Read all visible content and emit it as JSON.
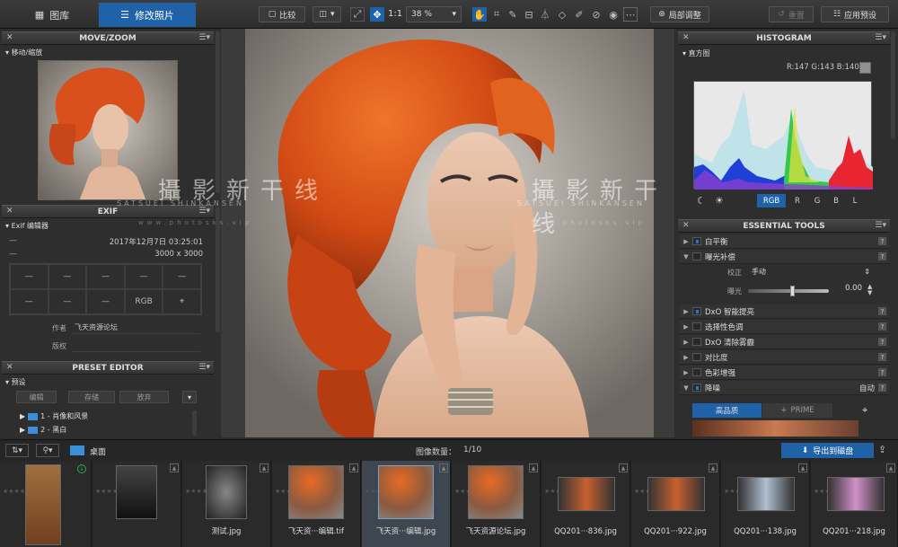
{
  "toolbar": {
    "library_tab": "图库",
    "customize_tab": "修改照片",
    "compare_button": "比较",
    "zoom_fit": "1:1",
    "zoom_level": "38 %",
    "local_adjust": "局部调整",
    "redo": "重置",
    "apply_preset": "应用预设"
  },
  "move_zoom": {
    "title": "MOVE/ZOOM",
    "sub": "移动/缩放"
  },
  "exif": {
    "title": "EXIF",
    "sub": "Exif 编辑器",
    "date": "2017年12月7日 03:25:01",
    "size": "3000 x 3000",
    "grid": [
      "—",
      "—",
      "—",
      "—",
      "—",
      "—",
      "—",
      "—",
      "RGB",
      ""
    ],
    "author_label": "作者",
    "author_value": "飞天资源论坛",
    "copyright_label": "版权",
    "copyright_value": ""
  },
  "preset": {
    "title": "PRESET EDITOR",
    "sub": "预设",
    "edit": "编辑",
    "save": "存储",
    "discard": "放弃",
    "items": [
      "1 - 肖像和风景",
      "2 - 黑白"
    ]
  },
  "watermark": {
    "main": "攝影新干线",
    "sub": "SATSUEI SHINKANSEN",
    "url": "www.photosks.vip"
  },
  "histogram": {
    "title": "HISTOGRAM",
    "sub": "直方图",
    "readout": "R:147 G:143 B:140",
    "channels": [
      "RGB",
      "R",
      "G",
      "B",
      "L"
    ]
  },
  "tools": {
    "title": "ESSENTIAL TOOLS",
    "white_balance": "白平衡",
    "exposure": "曝光补偿",
    "correction_label": "校正",
    "correction_value": "手动",
    "exposure_label": "曝光",
    "exposure_value": "0.00",
    "exposure_slider": 0.55,
    "smart_lighting": "DxO 智能提亮",
    "selective_tone": "选择性色调",
    "clear_view": "DxO 清除雾霾",
    "contrast": "对比度",
    "color_boost": "色彩增强",
    "noise": "降噪",
    "noise_mode": "自动",
    "hq": "高品质",
    "prime": "PRIME"
  },
  "filmstrip": {
    "folder": "桌面",
    "count_label": "图像数量：",
    "count_value": "1/10",
    "export": "导出到磁盘",
    "items": [
      "",
      "",
      "测试.jpg",
      "飞天资···编辑.tif",
      "飞天资···编辑.jpg",
      "飞天资源论坛.jpg",
      "QQ201···836.jpg",
      "QQ201···922.jpg",
      "QQ201···138.jpg",
      "QQ201···218.jpg"
    ]
  }
}
